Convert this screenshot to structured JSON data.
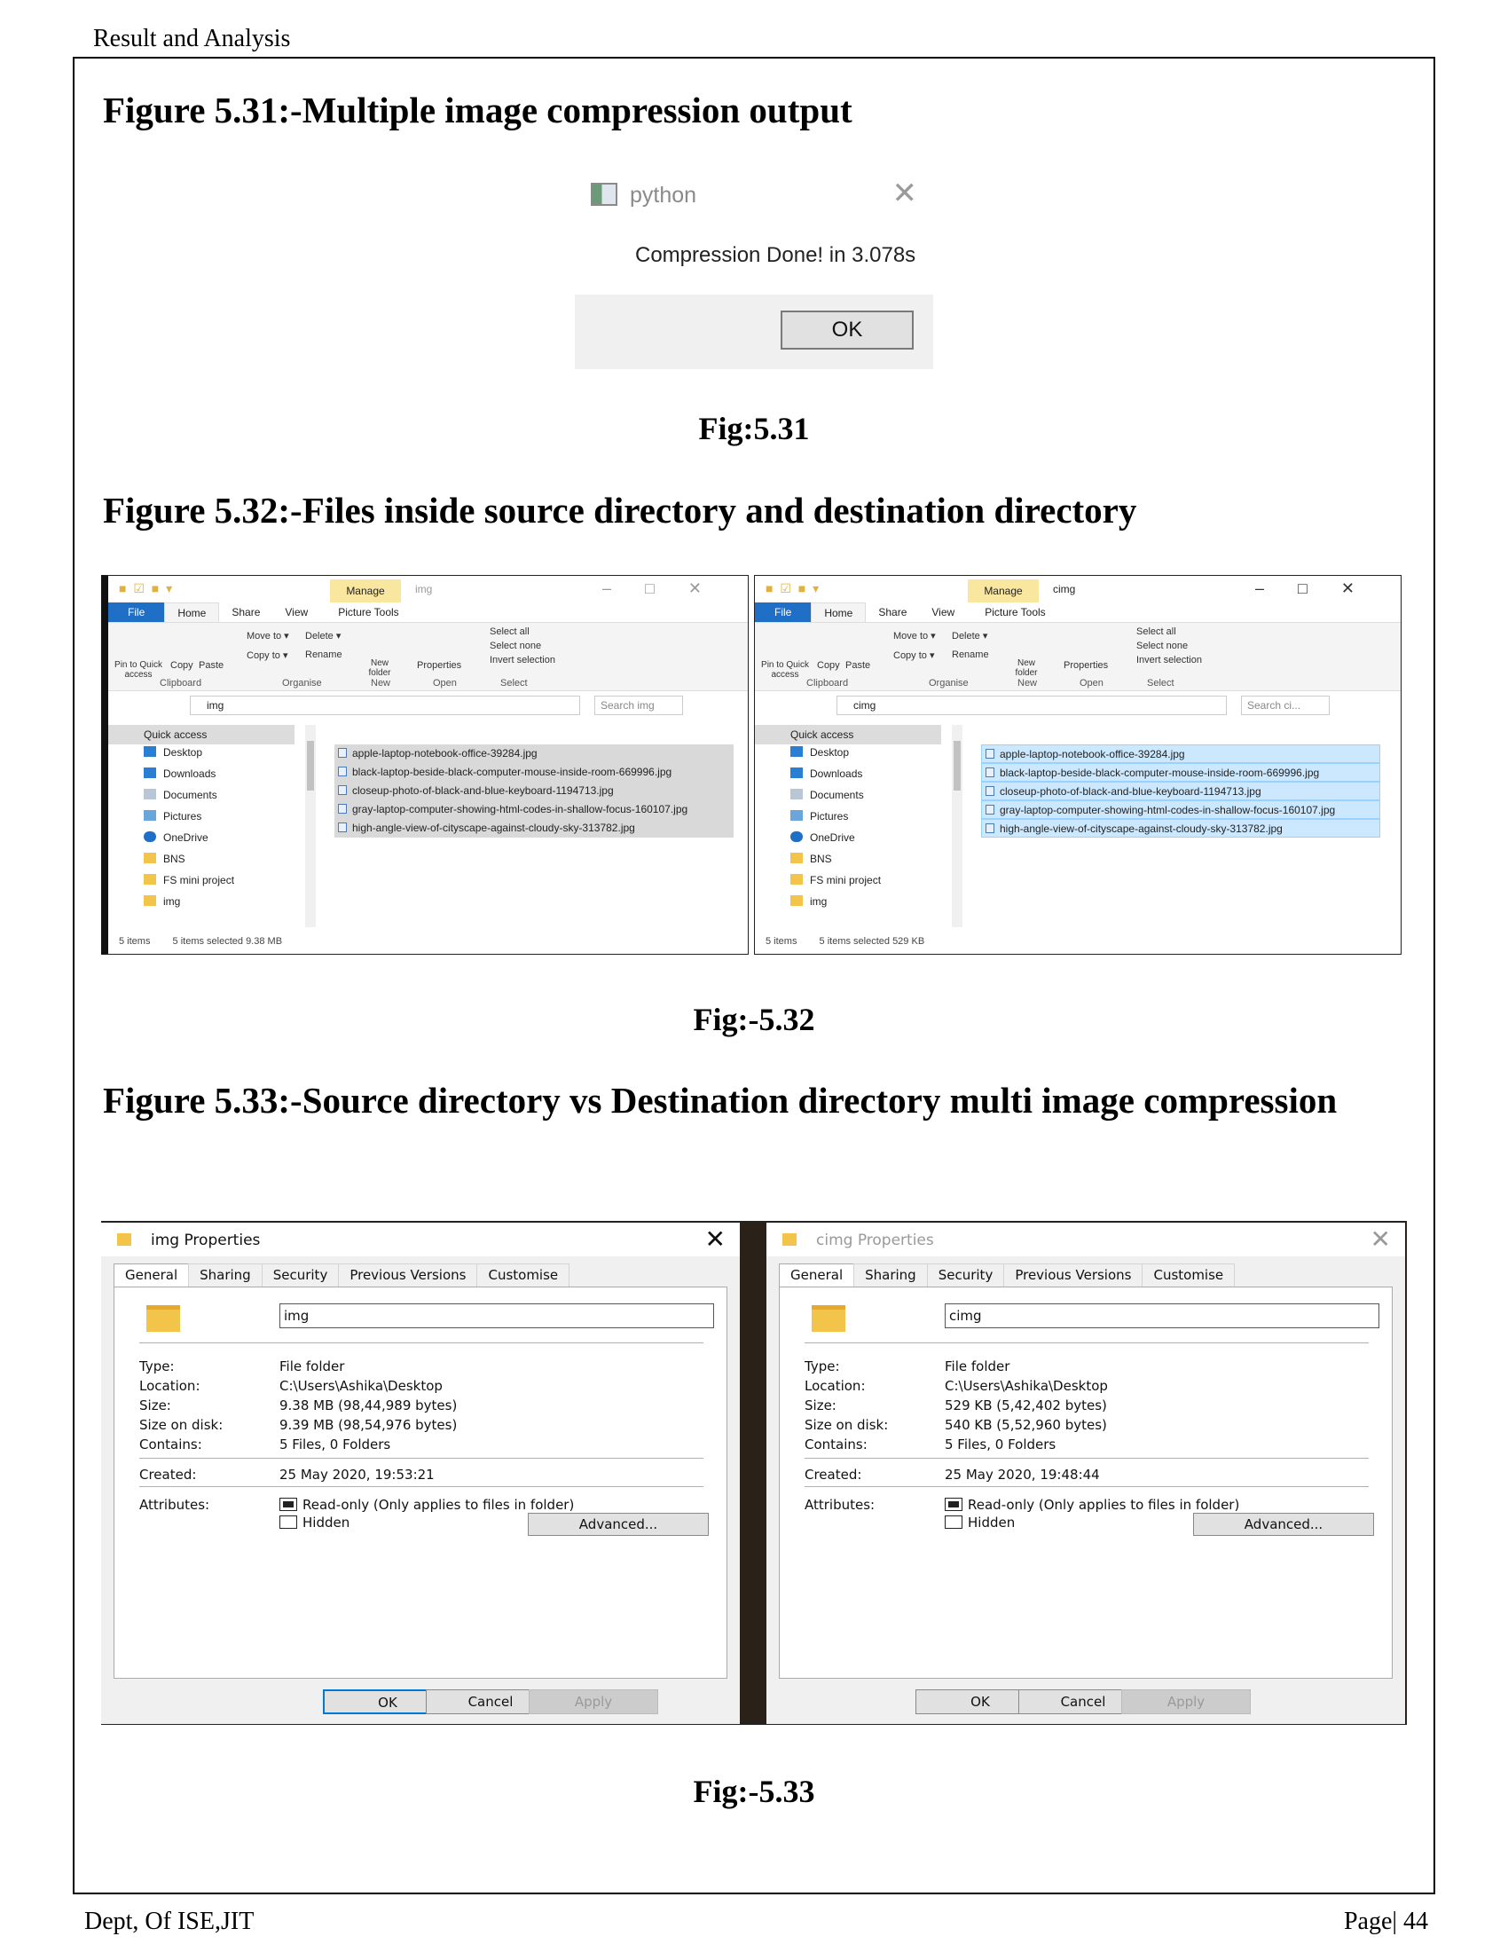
{
  "header": {
    "text": "Result and Analysis"
  },
  "footer": {
    "left": "Dept, Of ISE,JIT",
    "right": "Page| 44"
  },
  "fig531": {
    "heading": "Figure 5.31:-Multiple image compression output",
    "dialog": {
      "title": "python",
      "message": "Compression Done! in 3.078s",
      "ok": "OK"
    },
    "caption": "Fig:5.31"
  },
  "fig532": {
    "heading": "Figure 5.32:-Files inside source directory and destination directory",
    "caption": "Fig:-5.32",
    "ribbon": {
      "tabs": [
        "File",
        "Home",
        "Share",
        "View",
        "Picture Tools"
      ],
      "manage": "Manage",
      "pin": "Pin to Quick access",
      "copy": "Copy",
      "paste": "Paste",
      "move_to": "Move to ▾",
      "copy_to": "Copy to ▾",
      "delete": "Delete ▾",
      "rename": "Rename",
      "new_folder": "New folder",
      "properties": "Properties",
      "select_all": "Select all",
      "select_none": "Select none",
      "invert": "Invert selection",
      "groups": [
        "Clipboard",
        "Organise",
        "New",
        "Open",
        "Select"
      ]
    },
    "nav": [
      "Quick access",
      "Desktop",
      "Downloads",
      "Documents",
      "Pictures",
      "OneDrive",
      "BNS",
      "FS mini project",
      "img"
    ],
    "files": [
      "apple-laptop-notebook-office-39284.jpg",
      "black-laptop-beside-black-computer-mouse-inside-room-669996.jpg",
      "closeup-photo-of-black-and-blue-keyboard-1194713.jpg",
      "gray-laptop-computer-showing-html-codes-in-shallow-focus-160107.jpg",
      "high-angle-view-of-cityscape-against-cloudy-sky-313782.jpg"
    ],
    "left": {
      "folder": "img",
      "search": "Search img",
      "items": "5 items",
      "selected": "5 items selected  9.38 MB"
    },
    "right": {
      "folder": "cimg",
      "search": "Search ci...",
      "items": "5 items",
      "selected": "5 items selected  529 KB"
    }
  },
  "fig533": {
    "heading": "Figure 5.33:-Source directory vs Destination directory multi image compression",
    "caption": "Fig:-5.33",
    "tabs": [
      "General",
      "Sharing",
      "Security",
      "Previous Versions",
      "Customise"
    ],
    "labels": {
      "type": "Type:",
      "location": "Location:",
      "size": "Size:",
      "size_on_disk": "Size on disk:",
      "contains": "Contains:",
      "created": "Created:",
      "attributes": "Attributes:"
    },
    "readonly": "Read-only (Only applies to files in folder)",
    "hidden": "Hidden",
    "advanced": "Advanced...",
    "buttons": {
      "ok": "OK",
      "cancel": "Cancel",
      "apply": "Apply"
    },
    "left": {
      "title": "img Properties",
      "name": "img",
      "type": "File folder",
      "location": "C:\\Users\\Ashika\\Desktop",
      "size": "9.38 MB (98,44,989 bytes)",
      "size_on_disk": "9.39 MB (98,54,976 bytes)",
      "contains": "5 Files, 0 Folders",
      "created": "25 May 2020, 19:53:21"
    },
    "right": {
      "title": "cimg Properties",
      "name": "cimg",
      "type": "File folder",
      "location": "C:\\Users\\Ashika\\Desktop",
      "size": "529 KB (5,42,402 bytes)",
      "size_on_disk": "540 KB (5,52,960 bytes)",
      "contains": "5 Files, 0 Folders",
      "created": "25 May 2020, 19:48:44"
    }
  }
}
